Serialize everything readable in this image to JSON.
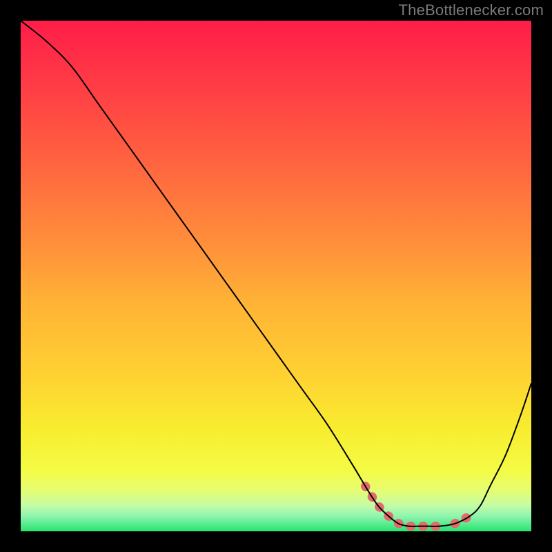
{
  "attribution": "TheBottlenecker.com",
  "chart_data": {
    "type": "line",
    "title": "",
    "xlabel": "",
    "ylabel": "",
    "xlim": [
      0,
      100
    ],
    "ylim": [
      0,
      100
    ],
    "grid": false,
    "legend": false,
    "series": [
      {
        "name": "curve",
        "x": [
          0,
          5,
          10,
          15,
          20,
          25,
          30,
          35,
          40,
          45,
          50,
          55,
          60,
          65,
          68,
          70,
          72,
          74,
          76,
          78,
          80,
          82,
          85,
          88,
          90,
          92,
          95,
          98,
          100
        ],
        "values": [
          100,
          96,
          91,
          84,
          77,
          70,
          63,
          56,
          49,
          42,
          35,
          28,
          21,
          13,
          8,
          5,
          3,
          1.5,
          1,
          1,
          1,
          1,
          1.5,
          3,
          5,
          9,
          15,
          23,
          29
        ]
      }
    ],
    "highlight_segments": [
      {
        "x_start": 67.5,
        "x_end": 71
      },
      {
        "x_start": 72,
        "x_end": 82.5
      },
      {
        "x_start": 85,
        "x_end": 88
      }
    ],
    "background_gradient": {
      "stops": [
        {
          "offset": 0.0,
          "color": "#ff1d49"
        },
        {
          "offset": 0.15,
          "color": "#ff4244"
        },
        {
          "offset": 0.3,
          "color": "#ff6a3f"
        },
        {
          "offset": 0.45,
          "color": "#ff933a"
        },
        {
          "offset": 0.55,
          "color": "#ffb236"
        },
        {
          "offset": 0.7,
          "color": "#ffd332"
        },
        {
          "offset": 0.8,
          "color": "#f8ed2f"
        },
        {
          "offset": 0.88,
          "color": "#f4fb44"
        },
        {
          "offset": 0.92,
          "color": "#e6fd72"
        },
        {
          "offset": 0.95,
          "color": "#c3fca6"
        },
        {
          "offset": 0.97,
          "color": "#8ff5b0"
        },
        {
          "offset": 1.0,
          "color": "#28e46f"
        }
      ]
    },
    "curve_stroke": "#000000",
    "highlight_color": "#e26a6a"
  }
}
